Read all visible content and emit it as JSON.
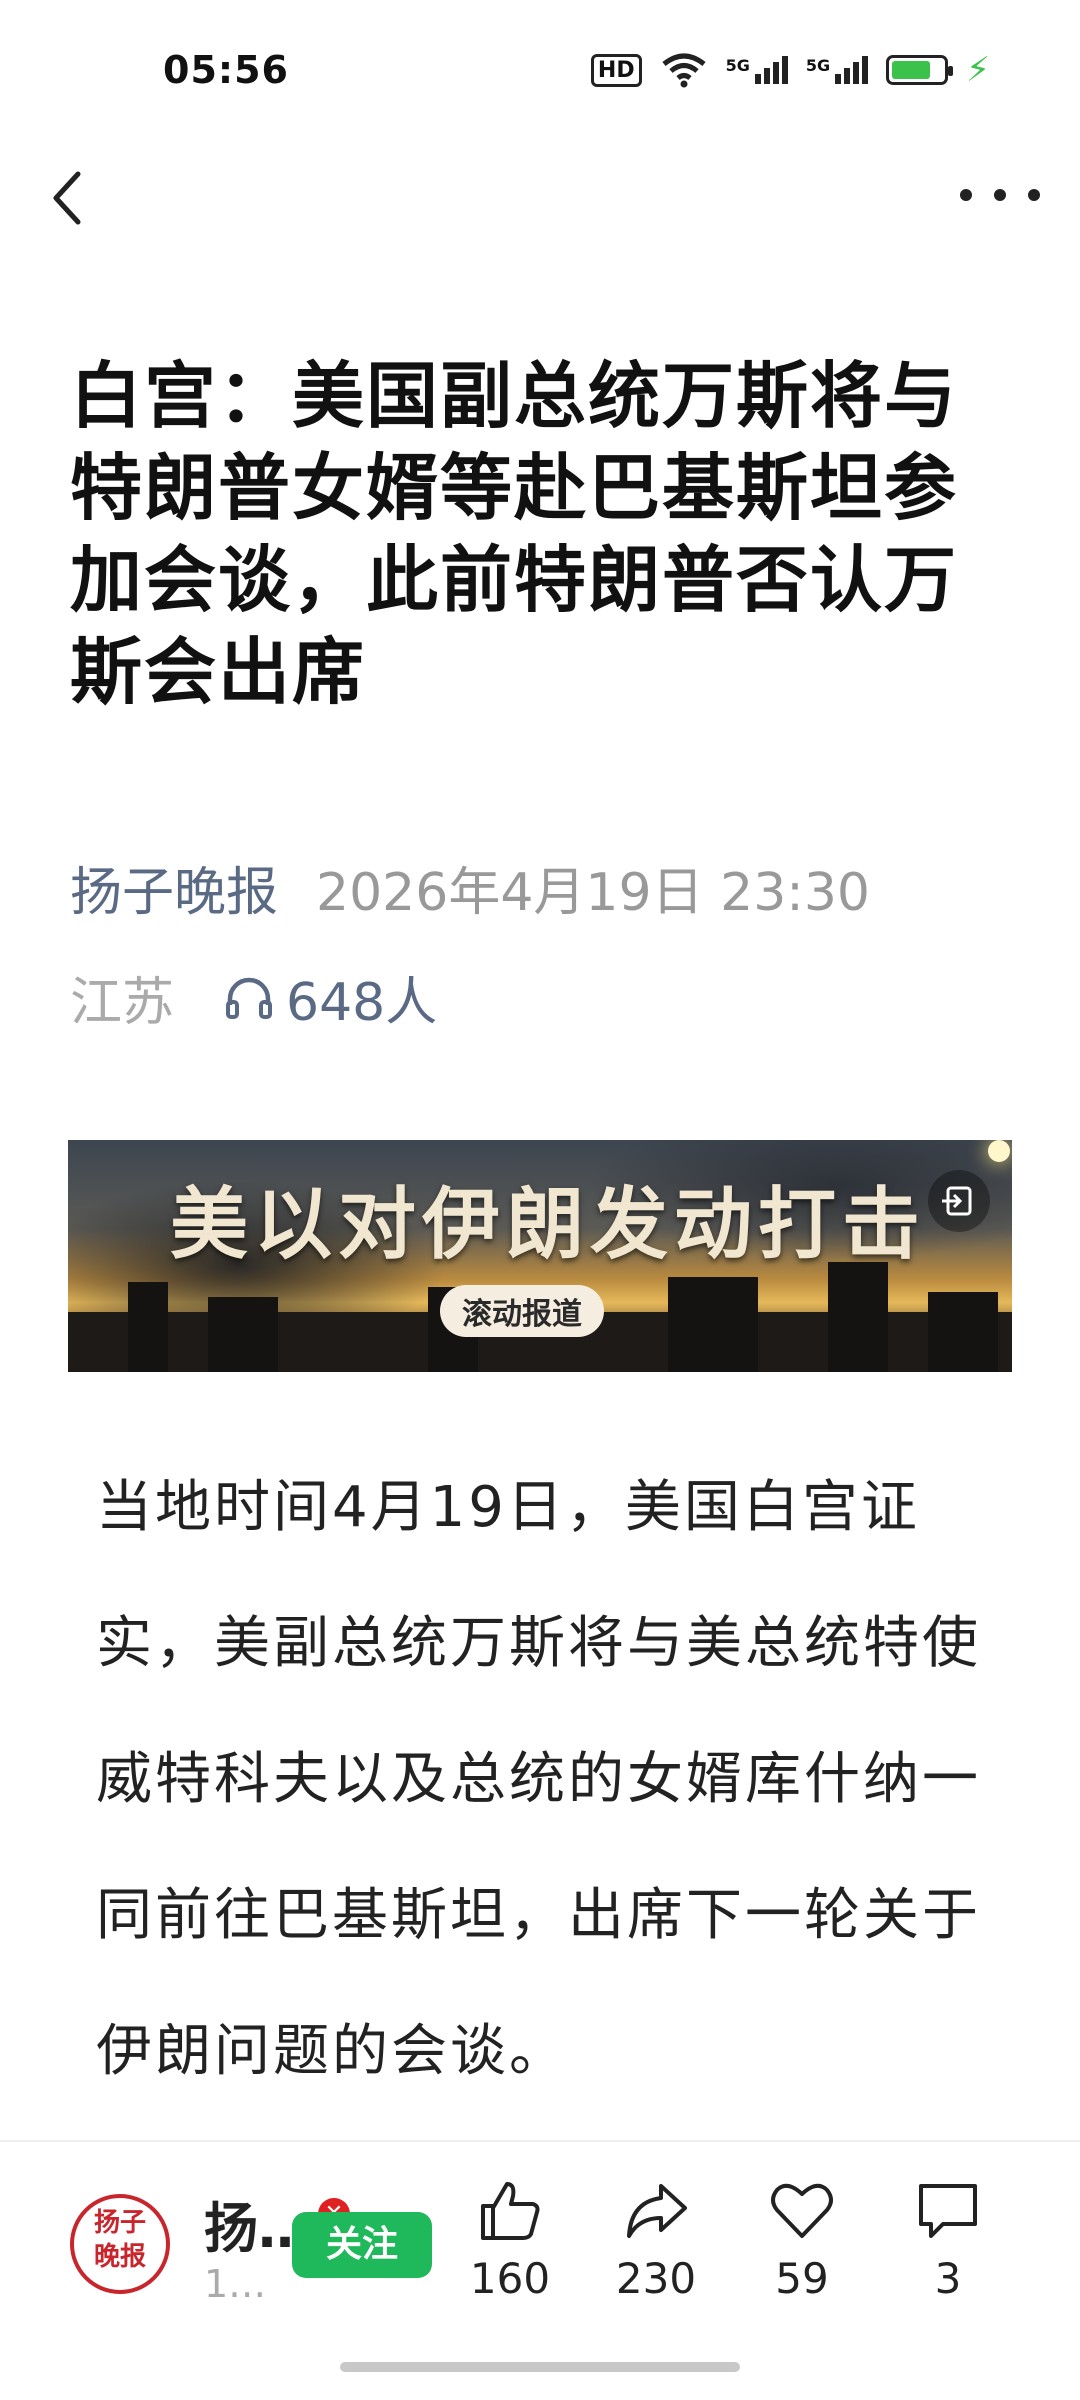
{
  "status_bar": {
    "time": "05:56",
    "network_badge": "HD",
    "signal1_label": "5G",
    "signal2_label": "5G",
    "battery_level": 0.75,
    "icons": [
      "hd-icon",
      "wifi-icon",
      "signal-5g-icon",
      "signal-5g-icon",
      "battery-icon",
      "charging-icon"
    ]
  },
  "nav": {
    "back_icon": "chevron-left-icon",
    "more_icon": "more-dots-icon"
  },
  "article": {
    "title": "白宫：美国副总统万斯将与特朗普女婿等赴巴基斯坦参加会谈，此前特朗普否认万斯会出席",
    "source": "扬子晚报",
    "datetime": "2026年4月19日 23:30",
    "location": "江苏",
    "listeners": "648人",
    "banner_title": "美以对伊朗发动打击",
    "banner_subtitle": "滚动报道",
    "body": "当地时间4月19日，美国白宫证实，美副总统万斯将与美总统特使威特科夫以及总统的女婿库什纳一同前往巴基斯坦，出席下一轮关于伊朗问题的会谈。"
  },
  "bottom_bar": {
    "account_logo_text": "扬子晚报",
    "account_name": "扬…",
    "account_sub": "1…",
    "follow_label": "关注",
    "like_count": "160",
    "share_count": "230",
    "favorite_count": "59",
    "comment_count": "3"
  },
  "colors": {
    "accent_green": "#1fb85a",
    "source_blue": "#5a6a85",
    "brand_red": "#c8262c"
  }
}
